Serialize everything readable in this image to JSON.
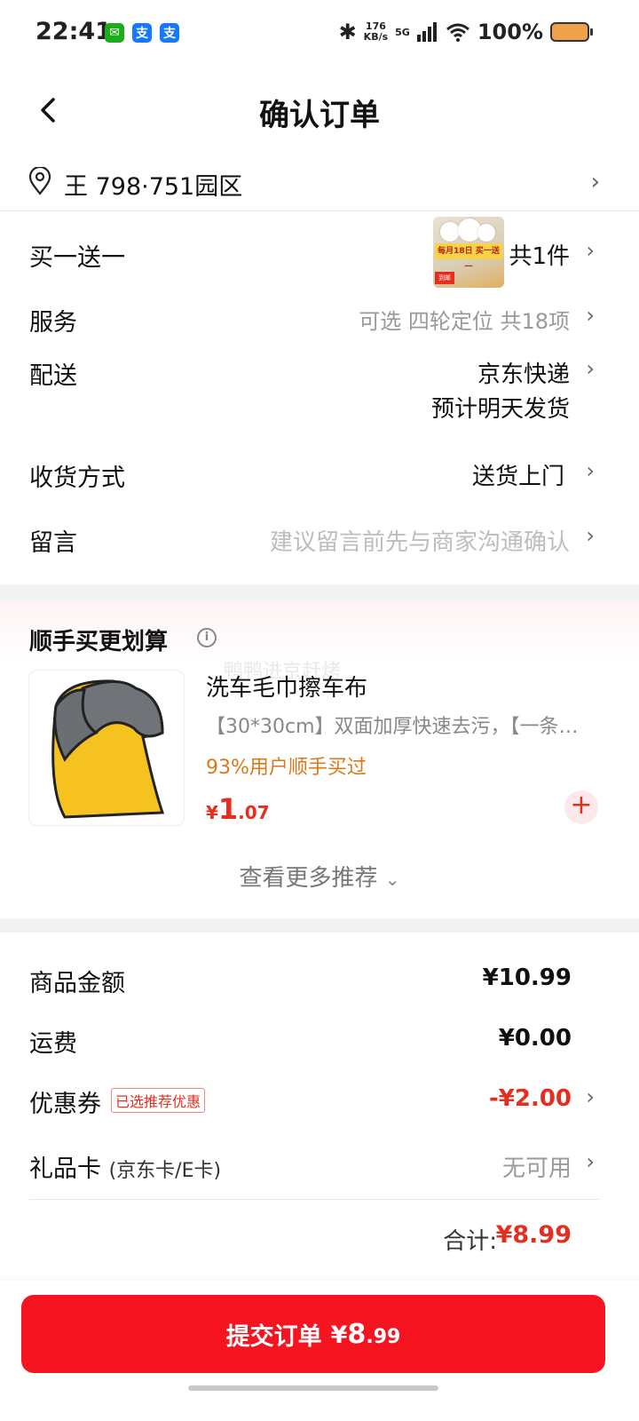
{
  "status_bar": {
    "time": "22:41",
    "net_speed_top": "176",
    "net_speed_bottom": "KB/s",
    "signal_label": "5G",
    "battery": "100%",
    "app_icons": [
      "wechat-icon",
      "alipay-icon",
      "alipay-icon"
    ]
  },
  "header": {
    "title": "确认订单"
  },
  "address": {
    "text": "王  798·751园区"
  },
  "order": {
    "promo": {
      "label": "买一送一",
      "count": "共1件",
      "thumb_banner": "每月18日 买一送一",
      "thumb_tag": "到邮"
    },
    "service": {
      "label": "服务",
      "value": "可选 四轮定位 共18项"
    },
    "delivery": {
      "label": "配送",
      "value": "京东快递",
      "sub": "预计明天发货"
    },
    "receive": {
      "label": "收货方式",
      "value": "送货上门"
    },
    "message": {
      "label": "留言",
      "placeholder": "建议留言前先与商家沟通确认"
    }
  },
  "recommend": {
    "title": "顺手买更划算",
    "watermark": "鸭鸭进京赶烤",
    "item": {
      "name": "洗车毛巾擦车布",
      "desc": "【30*30cm】双面加厚快速去污，【一条…",
      "bought": "93%用户顺手买过",
      "price_currency": "¥",
      "price_int": "1",
      "price_dec": ".07"
    },
    "more": "查看更多推荐"
  },
  "summary": {
    "goods": {
      "label": "商品金额",
      "value": "¥10.99"
    },
    "shipping": {
      "label": "运费",
      "value": "¥0.00"
    },
    "coupon": {
      "label": "优惠券",
      "badge": "已选推荐优惠",
      "value": "-¥2.00"
    },
    "gift_card": {
      "label": "礼品卡",
      "sub": "(京东卡/E卡)",
      "value": "无可用"
    },
    "total_label": "合计:",
    "total_value": "¥8.99"
  },
  "submit": {
    "label": "提交订单",
    "currency": "¥",
    "int": "8",
    "dec": ".99"
  },
  "colors": {
    "accent": "#f5141f",
    "price_red": "#e62e1f",
    "bought_orange": "#d87a1a"
  }
}
